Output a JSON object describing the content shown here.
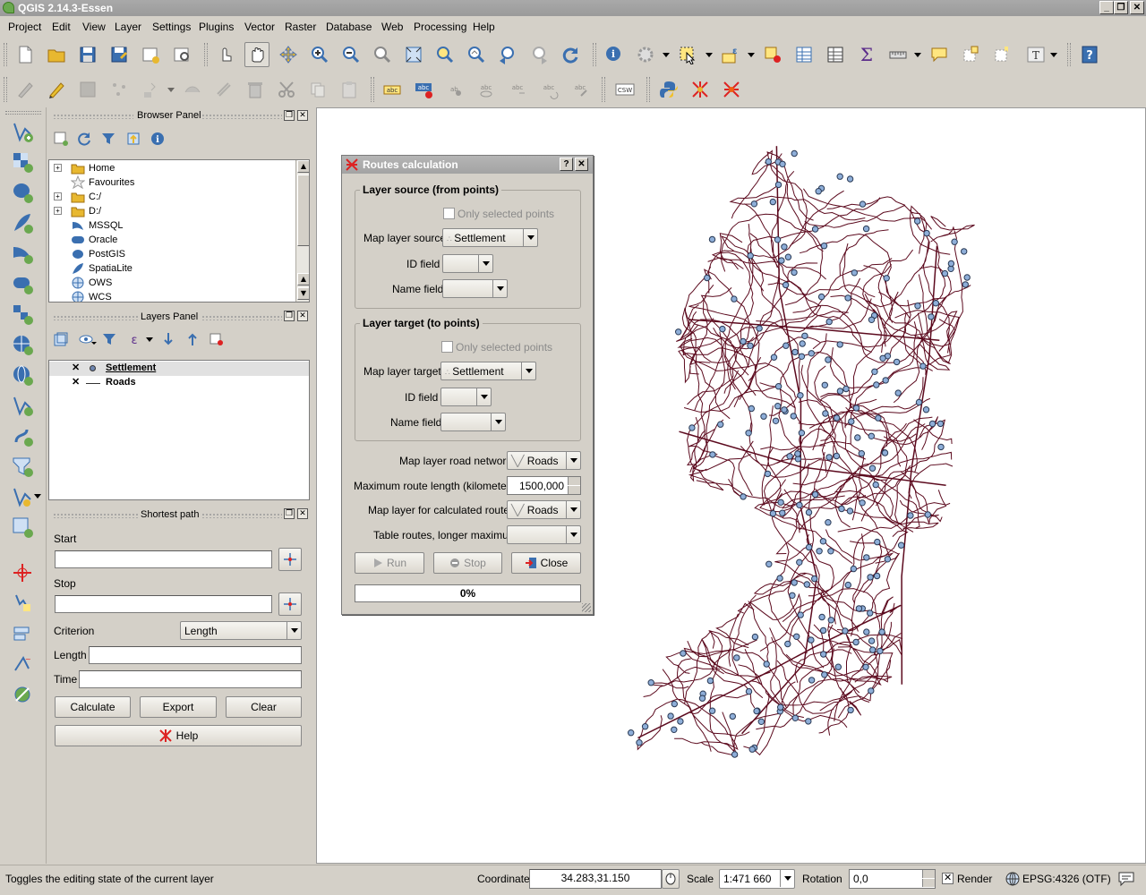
{
  "window": {
    "title": "QGIS 2.14.3-Essen"
  },
  "menu": [
    "Project",
    "Edit",
    "View",
    "Layer",
    "Settings",
    "Plugins",
    "Vector",
    "Raster",
    "Database",
    "Web",
    "Processing",
    "Help"
  ],
  "toolbar2": {
    "csw_label": "CSW"
  },
  "browser": {
    "title": "Browser Panel",
    "items": [
      {
        "label": "Home",
        "icon": "folder-icon",
        "expandable": true
      },
      {
        "label": "Favourites",
        "icon": "star-icon",
        "expandable": false
      },
      {
        "label": "C:/",
        "icon": "folder-icon",
        "expandable": true
      },
      {
        "label": "D:/",
        "icon": "folder-icon",
        "expandable": true
      },
      {
        "label": "MSSQL",
        "icon": "mssql-icon",
        "expandable": false
      },
      {
        "label": "Oracle",
        "icon": "oracle-icon",
        "expandable": false
      },
      {
        "label": "PostGIS",
        "icon": "elephant-icon",
        "expandable": false
      },
      {
        "label": "SpatiaLite",
        "icon": "feather-icon",
        "expandable": false
      },
      {
        "label": "OWS",
        "icon": "globe-icon",
        "expandable": false
      },
      {
        "label": "WCS",
        "icon": "globe-icon",
        "expandable": false
      }
    ]
  },
  "layers": {
    "title": "Layers Panel",
    "items": [
      {
        "label": "Settlement",
        "checked": true,
        "selected": true,
        "symbol": "point-icon"
      },
      {
        "label": "Roads",
        "checked": true,
        "selected": false,
        "symbol": "line-icon"
      }
    ]
  },
  "shortest_path": {
    "title": "Shortest path",
    "start_label": "Start",
    "start_value": "",
    "stop_label": "Stop",
    "stop_value": "",
    "criterion_label": "Criterion",
    "criterion_value": "Length",
    "length_label": "Length",
    "length_value": "",
    "time_label": "Time",
    "time_value": "",
    "calculate_label": "Calculate",
    "export_label": "Export",
    "clear_label": "Clear",
    "help_label": "Help"
  },
  "dialog": {
    "title": "Routes calculation",
    "help_btn": "?",
    "close_btn": "✕",
    "source_group": "Layer source (from points)",
    "source_only_selected": "Only selected points",
    "source_layer_label": "Map layer source",
    "source_layer_value": "Settlement",
    "source_id_label": "ID field",
    "source_id_value": "",
    "source_name_label": "Name field",
    "source_name_value": "",
    "target_group": "Layer target (to points)",
    "target_only_selected": "Only selected points",
    "target_layer_label": "Map layer target",
    "target_layer_value": "Settlement",
    "target_id_label": "ID field",
    "target_id_value": "",
    "target_name_label": "Name field",
    "target_name_value": "",
    "road_network_label": "Map layer road network",
    "road_network_value": "Roads",
    "max_length_label": "Maximum route length (kilometers)",
    "max_length_value": "1500,000",
    "calc_routes_label": "Map layer for calculated routes",
    "calc_routes_value": "Roads",
    "table_routes_label": "Table routes, longer maximum",
    "table_routes_value": "",
    "run_label": "Run",
    "stop_label": "Stop",
    "close_label": "Close",
    "progress_text": "0%",
    "progress_value": 0
  },
  "status": {
    "message": "Toggles the editing state of the current layer",
    "coordinate_label": "Coordinate",
    "coordinate_value": "34.283,31.150",
    "scale_label": "Scale",
    "scale_value": "1:471 660",
    "rotation_label": "Rotation",
    "rotation_value": "0,0",
    "render_label": "Render",
    "render_checked": true,
    "crs_label": "EPSG:4326 (OTF)"
  },
  "colors": {
    "road_line": "#5c0a1e",
    "settlement_fill": "#8eaed8",
    "settlement_stroke": "#2a3a55"
  }
}
